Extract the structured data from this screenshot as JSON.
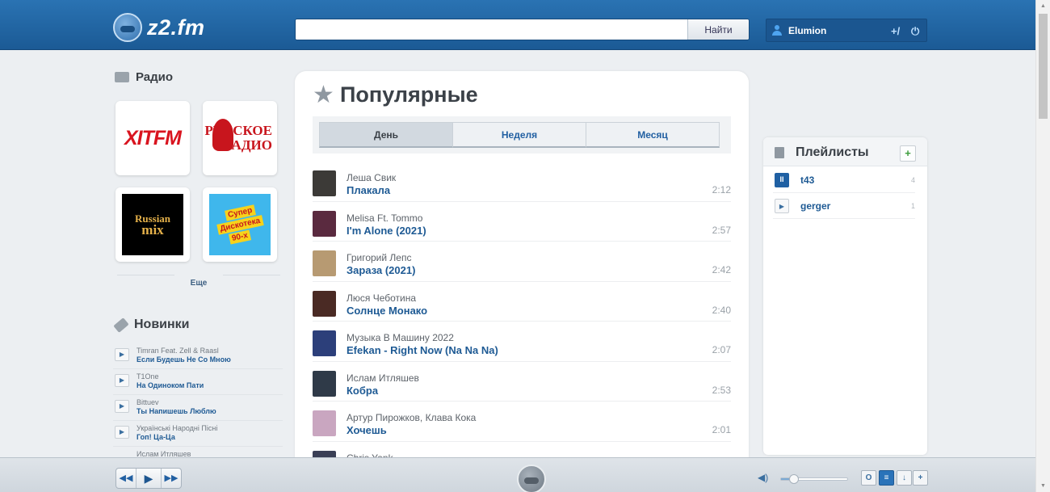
{
  "header": {
    "logo": "z2.fm",
    "search": {
      "value": "",
      "placeholder": "",
      "button": "Найти"
    },
    "user": {
      "name": "Elumion",
      "add_icon": "add-user-icon",
      "power_icon": "power-icon"
    }
  },
  "radio": {
    "title": "Радио",
    "stations": [
      {
        "name": "XIT FM",
        "logo_text": "XITFM"
      },
      {
        "name": "Русское Радио",
        "logo_line1": "РУССКОЕ",
        "logo_line2": "РАДИО"
      },
      {
        "name": "Russian Mix",
        "logo_line1": "Russian",
        "logo_line2": "mix"
      },
      {
        "name": "Супер Дискотека 90х",
        "logo_line1": "Супер",
        "logo_line2": "Дискотека",
        "logo_line3": "90-х"
      }
    ],
    "more": "Еще"
  },
  "new": {
    "title": "Новинки",
    "items": [
      {
        "artist": "Timran Feat. Zell & Raasl",
        "title": "Если Будешь Не Со Мною"
      },
      {
        "artist": "T1One",
        "title": "На Одиноком Пати"
      },
      {
        "artist": "Bittuev",
        "title": "Ты Напишешь Люблю"
      },
      {
        "artist": "Українські Народні Пісні",
        "title": "Гоп! Ца-Ца"
      },
      {
        "artist": "Ислам Итляшев",
        "title": ""
      }
    ]
  },
  "popular": {
    "title": "Популярные",
    "tabs": [
      {
        "label": "День",
        "active": true
      },
      {
        "label": "Неделя",
        "active": false
      },
      {
        "label": "Месяц",
        "active": false
      }
    ],
    "tracks": [
      {
        "artist": "Леша Свик",
        "title": "Плакала",
        "duration": "2:12",
        "cover": "#3c3a37"
      },
      {
        "artist": "Melisa Ft. Tommo",
        "title": "I'm Alone (2021)",
        "duration": "2:57",
        "cover": "#5a2a3f"
      },
      {
        "artist": "Григорий Лепс",
        "title": "Зараза (2021)",
        "duration": "2:42",
        "cover": "#b79a72"
      },
      {
        "artist": "Люся Чеботина",
        "title": "Солнце Монако",
        "duration": "2:40",
        "cover": "#4a2a24"
      },
      {
        "artist": "Музыка В Машину 2022",
        "title": "Efekan - Right Now (Na Na Na)",
        "duration": "2:07",
        "cover": "#2c3f7a"
      },
      {
        "artist": "Ислам Итляшев",
        "title": "Кобра",
        "duration": "2:53",
        "cover": "#2f3a48"
      },
      {
        "artist": "Артур Пирожков, Клава Кока",
        "title": "Хочешь",
        "duration": "2:01",
        "cover": "#c9a6c0"
      },
      {
        "artist": "Chris Yank",
        "title": "",
        "duration": "",
        "cover": "#3a3f55"
      }
    ]
  },
  "playlists": {
    "title": "Плейлисты",
    "add": "+",
    "items": [
      {
        "name": "t43",
        "count": "4",
        "state": "playing"
      },
      {
        "name": "gerger",
        "count": "1",
        "state": "stopped"
      }
    ]
  },
  "player": {
    "prev": "◀◀",
    "play": "▶",
    "next": "▶▶",
    "volume": 0.2,
    "buttons": {
      "repeat": "O",
      "list": "≡",
      "download": "↓",
      "add": "+"
    }
  },
  "colors": {
    "header": "#1f64a3",
    "link": "#1e5a94",
    "accent_green": "#3b9c3b"
  }
}
